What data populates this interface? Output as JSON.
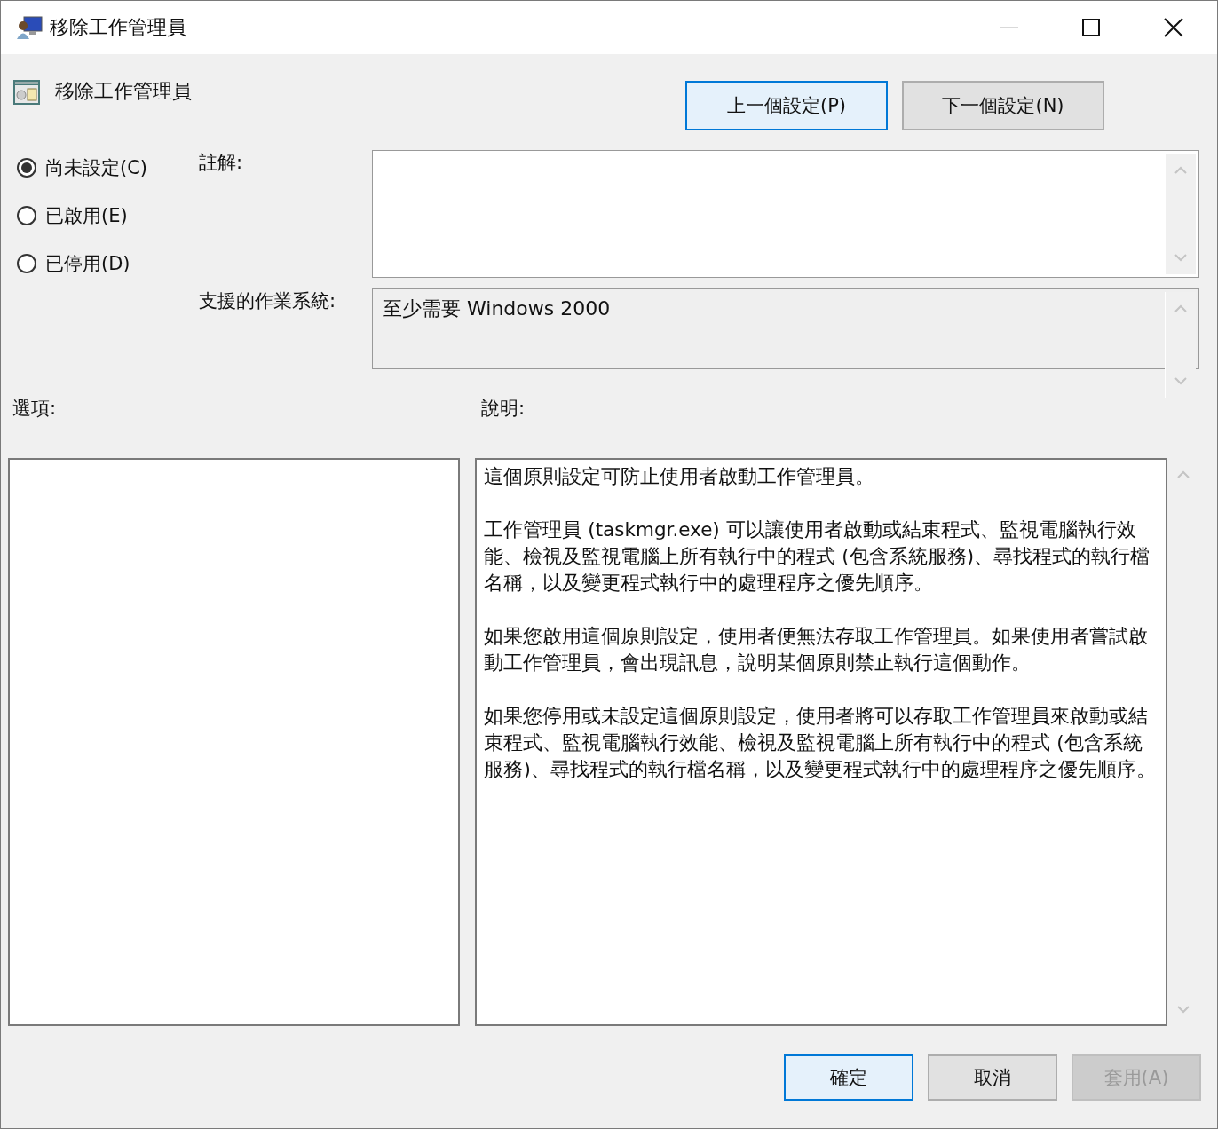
{
  "window": {
    "title": "移除工作管理員"
  },
  "header": {
    "title": "移除工作管理員"
  },
  "nav_buttons": [
    {
      "label": "上一個設定(P)",
      "focused": true
    },
    {
      "label": "下一個設定(N)",
      "focused": false
    }
  ],
  "state_options": [
    {
      "label": "尚未設定(C)",
      "selected": true
    },
    {
      "label": "已啟用(E)",
      "selected": false
    },
    {
      "label": "已停用(D)",
      "selected": false
    }
  ],
  "comment": {
    "label": "註解:"
  },
  "supported_on": {
    "label": "支援的作業系統:",
    "value": "至少需要 Windows 2000"
  },
  "options": {
    "label": "選項:"
  },
  "help": {
    "label": "說明:",
    "paragraphs": [
      "這個原則設定可防止使用者啟動工作管理員。",
      "工作管理員 (taskmgr.exe) 可以讓使用者啟動或結束程式、監視電腦執行效能、檢視及監視電腦上所有執行中的程式 (包含系統服務)、尋找程式的執行檔名稱，以及變更程式執行中的處理程序之優先順序。",
      "如果您啟用這個原則設定，使用者便無法存取工作管理員。如果使用者嘗試啟動工作管理員，會出現訊息，說明某個原則禁止執行這個動作。",
      "如果您停用或未設定這個原則設定，使用者將可以存取工作管理員來啟動或結束程式、監視電腦執行效能、檢視及監視電腦上所有執行中的程式 (包含系統服務)、尋找程式的執行檔名稱，以及變更程式執行中的處理程序之優先順序。"
    ]
  },
  "buttons": [
    {
      "label": "確定",
      "focused": true,
      "disabled": false
    },
    {
      "label": "取消",
      "focused": false,
      "disabled": false
    },
    {
      "label": "套用(A)",
      "focused": false,
      "disabled": true
    }
  ]
}
